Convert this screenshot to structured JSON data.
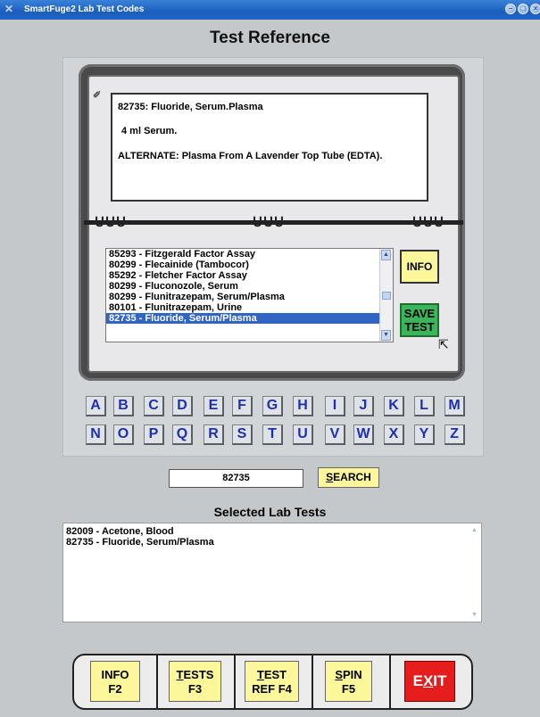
{
  "window": {
    "title": "SmartFuge2 Lab Test Codes",
    "app_icon": "x-icon",
    "controls": [
      "minimize",
      "maximize",
      "close"
    ]
  },
  "page_title": "Test Reference",
  "card": {
    "line1": "82735:  Fluoride, Serum.Plasma",
    "line2": "4 ml Serum.",
    "line3": "ALTERNATE: Plasma From A Lavender Top Tube (EDTA)."
  },
  "test_list": {
    "items": [
      "85293 - Fitzgerald Factor Assay",
      "80299 - Flecainide (Tambocor)",
      "85292 - Fletcher Factor Assay",
      "80299 - Fluconozole, Serum",
      "80299 - Flunitrazepam, Serum/Plasma",
      "80101 - Flunitrazepam, Urine",
      "82735 - Fluoride, Serum/Plasma"
    ],
    "selected_index": 6
  },
  "buttons": {
    "info": "INFO",
    "save_line1": "SAVE",
    "save_line2": "TEST"
  },
  "alphabet": [
    "A",
    "B",
    "C",
    "D",
    "E",
    "F",
    "G",
    "H",
    "I",
    "J",
    "K",
    "L",
    "M",
    "N",
    "O",
    "P",
    "Q",
    "R",
    "S",
    "T",
    "U",
    "V",
    "W",
    "X",
    "Y",
    "Z"
  ],
  "search": {
    "value": "82735",
    "button_hotkey": "S",
    "button_rest": "EARCH"
  },
  "selected": {
    "title": "Selected Lab Tests",
    "items": [
      "82009 - Acetone, Blood",
      "82735 - Fluoride, Serum/Plasma"
    ]
  },
  "bottom": {
    "info_l1": "INFO",
    "info_l2": "F2",
    "tests_hot": "T",
    "tests_rest": "ESTS",
    "tests_l2": "F3",
    "ref_hot": "T",
    "ref_rest": "EST",
    "ref_l2": "REF F4",
    "spin_hot": "S",
    "spin_rest": "PIN",
    "spin_l2": "F5",
    "exit_pre": "E",
    "exit_hot": "X",
    "exit_post": "IT"
  },
  "colors": {
    "accent_yellow": "#fbf79a",
    "save_green": "#3cb55a",
    "exit_red": "#e51d1d",
    "selection_blue": "#3164c5",
    "letter_blue": "#1e2fb0"
  }
}
